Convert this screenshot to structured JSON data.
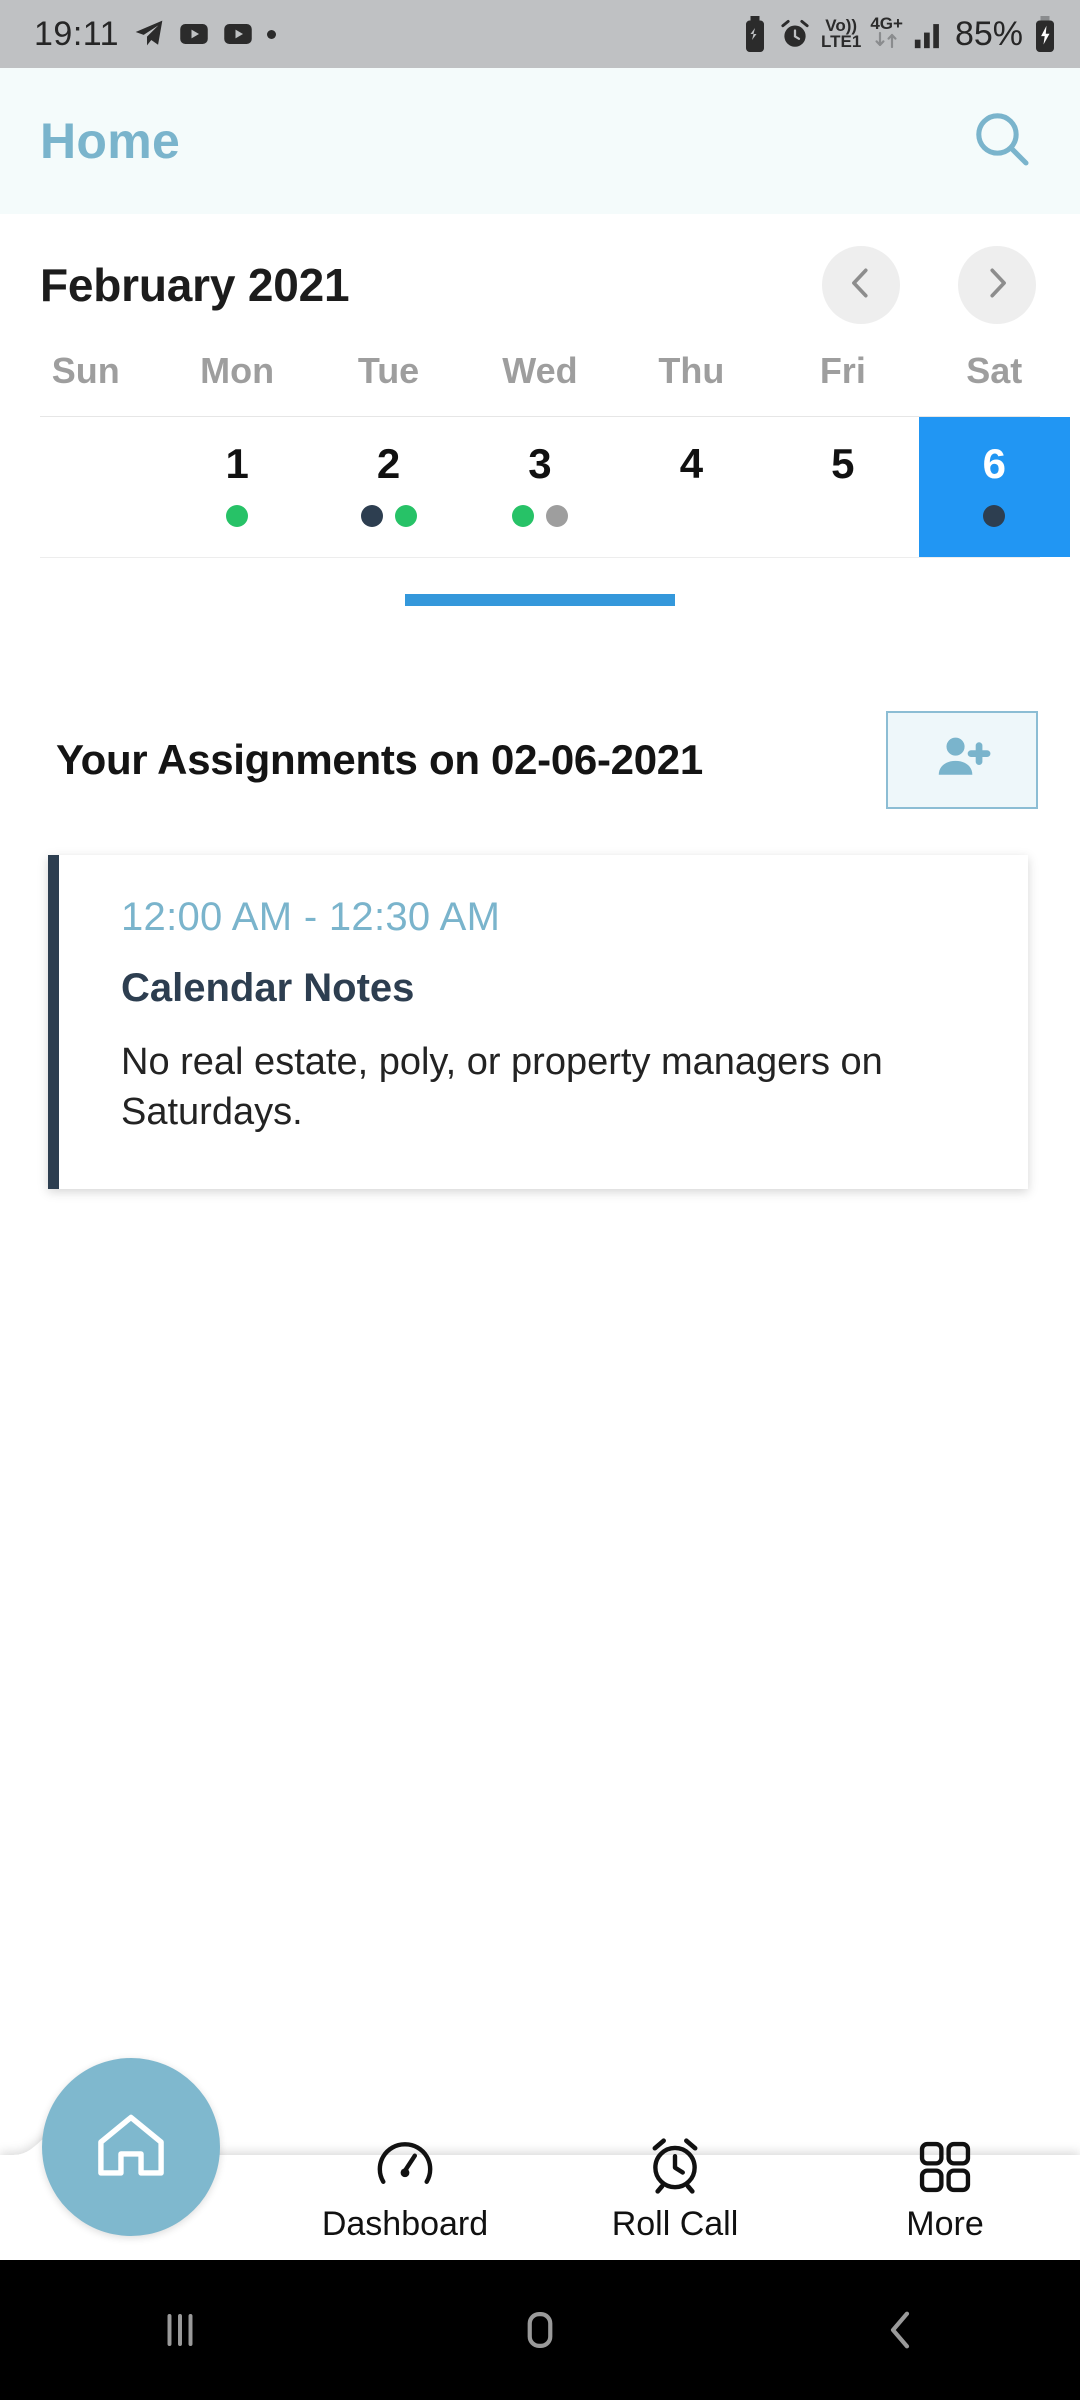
{
  "status_bar": {
    "time": "19:11",
    "left_icons": [
      "telegram-icon",
      "youtube-icon",
      "youtube-music-icon",
      "dot-indicator-icon"
    ],
    "battery_saver_icon": "battery-saver-icon",
    "alarm_icon": "alarm-icon",
    "volte_line1": "Vo))",
    "volte_line2": "LTE1",
    "network_type": "4G+",
    "signal_icon": "signal-bars-icon",
    "battery_percent": "85%",
    "battery_icon": "battery-charging-icon"
  },
  "header": {
    "title": "Home",
    "search_icon": "search-icon"
  },
  "calendar": {
    "month_label": "February 2021",
    "prev_icon": "chevron-left-icon",
    "next_icon": "chevron-right-icon",
    "day_names": [
      "Sun",
      "Mon",
      "Tue",
      "Wed",
      "Thu",
      "Fri",
      "Sat"
    ],
    "days": [
      {
        "label": "",
        "selected": false,
        "dots": []
      },
      {
        "label": "1",
        "selected": false,
        "dots": [
          "#27c267"
        ]
      },
      {
        "label": "2",
        "selected": false,
        "dots": [
          "#2d3e50",
          "#27c267"
        ]
      },
      {
        "label": "3",
        "selected": false,
        "dots": [
          "#27c267",
          "#9e9e9e"
        ]
      },
      {
        "label": "4",
        "selected": false,
        "dots": []
      },
      {
        "label": "5",
        "selected": false,
        "dots": []
      },
      {
        "label": "6",
        "selected": true,
        "dots": [
          "#2d3e50"
        ]
      }
    ],
    "drag_handle": "expand-handle"
  },
  "assignments": {
    "heading": "Your Assignments on 02-06-2021",
    "add_person_icon": "person-add-icon",
    "cards": [
      {
        "time": "12:00 AM - 12:30 AM",
        "title": "Calendar Notes",
        "body": "No real estate, poly, or property managers on Saturdays."
      }
    ]
  },
  "bottom_nav": {
    "items": [
      {
        "label": "Home",
        "icon": "home-icon",
        "active": true
      },
      {
        "label": "Dashboard",
        "icon": "speedometer-icon",
        "active": false
      },
      {
        "label": "Roll Call",
        "icon": "alarm-clock-icon",
        "active": false
      },
      {
        "label": "More",
        "icon": "grid-squares-icon",
        "active": false
      }
    ]
  },
  "system_nav": {
    "recents_icon": "recents-icon",
    "home_icon": "home-square-icon",
    "back_icon": "back-chevron-icon"
  },
  "colors": {
    "accent_blue": "#7ab4cc",
    "selected_day": "#2196f3",
    "card_border": "#2d3e50",
    "green_dot": "#27c267",
    "gray_dot": "#9e9e9e",
    "header_bg": "#f4fbfb"
  }
}
